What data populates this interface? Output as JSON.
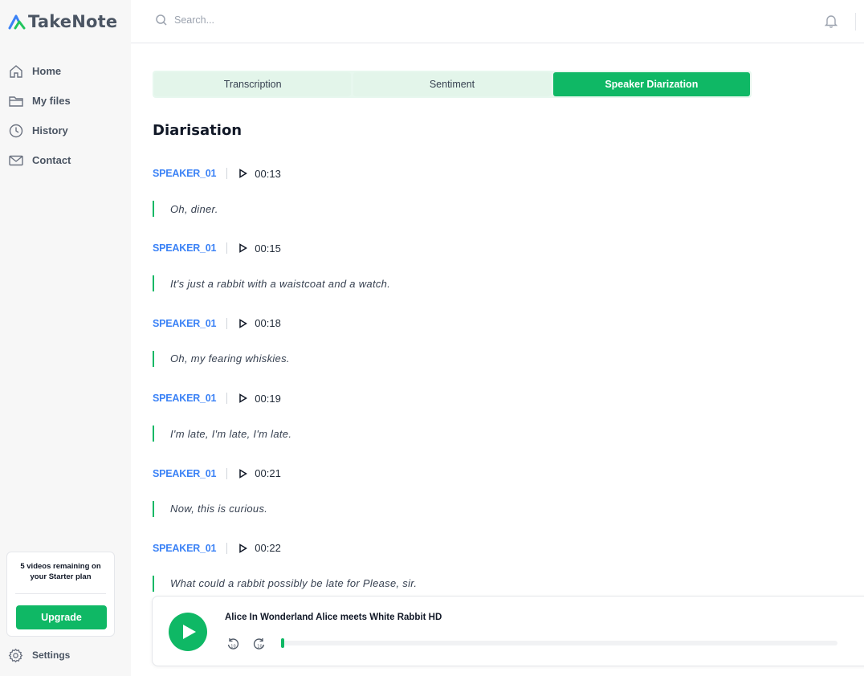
{
  "app": {
    "name": "TakeNote",
    "brand_color": "#0fb865",
    "speaker_color": "#3b82f6"
  },
  "sidebar": {
    "items": [
      {
        "label": "Home",
        "icon": "home-icon"
      },
      {
        "label": "My files",
        "icon": "folder-icon"
      },
      {
        "label": "History",
        "icon": "clock-icon"
      },
      {
        "label": "Contact",
        "icon": "mail-icon"
      }
    ],
    "plan": {
      "text": "5 videos remaining on your Starter plan",
      "upgrade_label": "Upgrade"
    },
    "settings_label": "Settings"
  },
  "header": {
    "search_placeholder": "Search..."
  },
  "tabs": [
    {
      "label": "Transcription",
      "active": false
    },
    {
      "label": "Sentiment",
      "active": false
    },
    {
      "label": "Speaker Diarization",
      "active": true
    }
  ],
  "section_title": "Diarisation",
  "entries": [
    {
      "speaker": "SPEAKER_01",
      "time": "00:13",
      "text": "Oh, diner."
    },
    {
      "speaker": "SPEAKER_01",
      "time": "00:15",
      "text": "It's just a rabbit with a waistcoat and a watch."
    },
    {
      "speaker": "SPEAKER_01",
      "time": "00:18",
      "text": "Oh, my fearing whiskies."
    },
    {
      "speaker": "SPEAKER_01",
      "time": "00:19",
      "text": "I'm late, I'm late, I'm late."
    },
    {
      "speaker": "SPEAKER_01",
      "time": "00:21",
      "text": "Now, this is curious."
    },
    {
      "speaker": "SPEAKER_01",
      "time": "00:22",
      "text": "What could a rabbit possibly be late for Please, sir."
    }
  ],
  "player": {
    "title": "Alice In Wonderland Alice meets White Rabbit HD",
    "skip_back_icon": "rewind-10-icon",
    "skip_forward_icon": "forward-10-icon",
    "progress": 0.005
  }
}
